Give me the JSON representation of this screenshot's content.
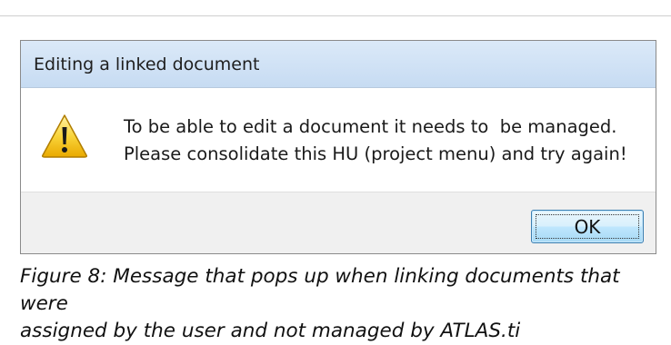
{
  "dialog": {
    "title": "Editing a linked document",
    "icon": "warning-icon",
    "message_line1": "To be able to edit a document it needs to  be managed.",
    "message_line2": "Please consolidate this HU (project menu) and try again!",
    "ok_label": "OK"
  },
  "caption": {
    "line1": "Figure 8: Message that pops up when linking documents that were",
    "line2": "assigned by the user and not managed by ATLAS.ti"
  },
  "colors": {
    "titlebar": "#cfe1f5",
    "footer": "#f0f0f0",
    "button_border": "#3c7fb1",
    "warning_yellow": "#f7c600"
  }
}
